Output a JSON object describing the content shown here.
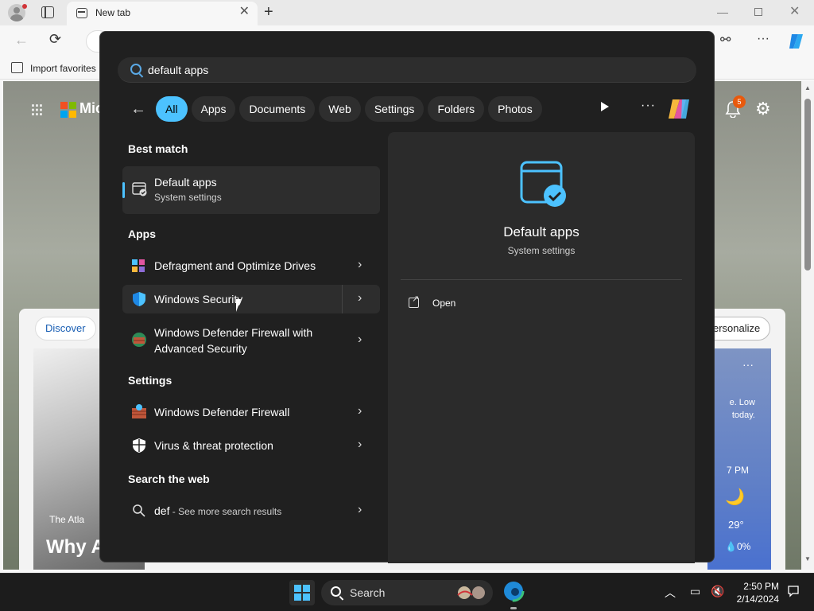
{
  "browser": {
    "tab_title": "New tab",
    "favorites_label": "Import favorites"
  },
  "newtab": {
    "brand_text": "Mic",
    "notification_count": "5",
    "discover_label": "Discover",
    "personalize_label": "ersonalize",
    "news_source": "The Atla",
    "news_title": "Why A",
    "weather": {
      "summary_line1": "e. Low",
      "summary_line2": "today.",
      "time": "7 PM",
      "temperature": "29°",
      "precip": "0%"
    }
  },
  "search": {
    "query": "default apps",
    "filters": [
      "All",
      "Apps",
      "Documents",
      "Web",
      "Settings",
      "Folders",
      "Photos"
    ],
    "active_filter": "All"
  },
  "results": {
    "best_match_header": "Best match",
    "best_match": {
      "title": "Default apps",
      "subtitle": "System settings"
    },
    "apps_header": "Apps",
    "apps": [
      {
        "label": "Defragment and Optimize Drives",
        "icon": "defrag-icon"
      },
      {
        "label": "Windows Security",
        "icon": "windows-security-icon"
      },
      {
        "label_line1": "Windows Defender Firewall with",
        "label_line2": "Advanced Security",
        "icon": "firewall-advanced-icon"
      }
    ],
    "settings_header": "Settings",
    "settings": [
      {
        "label": "Windows Defender Firewall",
        "icon": "firewall-icon"
      },
      {
        "label": "Virus & threat protection",
        "icon": "shield-icon"
      }
    ],
    "web_header": "Search the web",
    "web": {
      "query": "def",
      "suffix": " - See more search results"
    }
  },
  "detail": {
    "title": "Default apps",
    "subtitle": "System settings",
    "open_label": "Open"
  },
  "taskbar": {
    "search_label": "Search",
    "time": "2:50 PM",
    "date": "2/14/2024"
  },
  "colors": {
    "accent": "#4cc2ff",
    "flyout_bg": "#202020",
    "taskbar_bg": "#1c1c1c"
  }
}
